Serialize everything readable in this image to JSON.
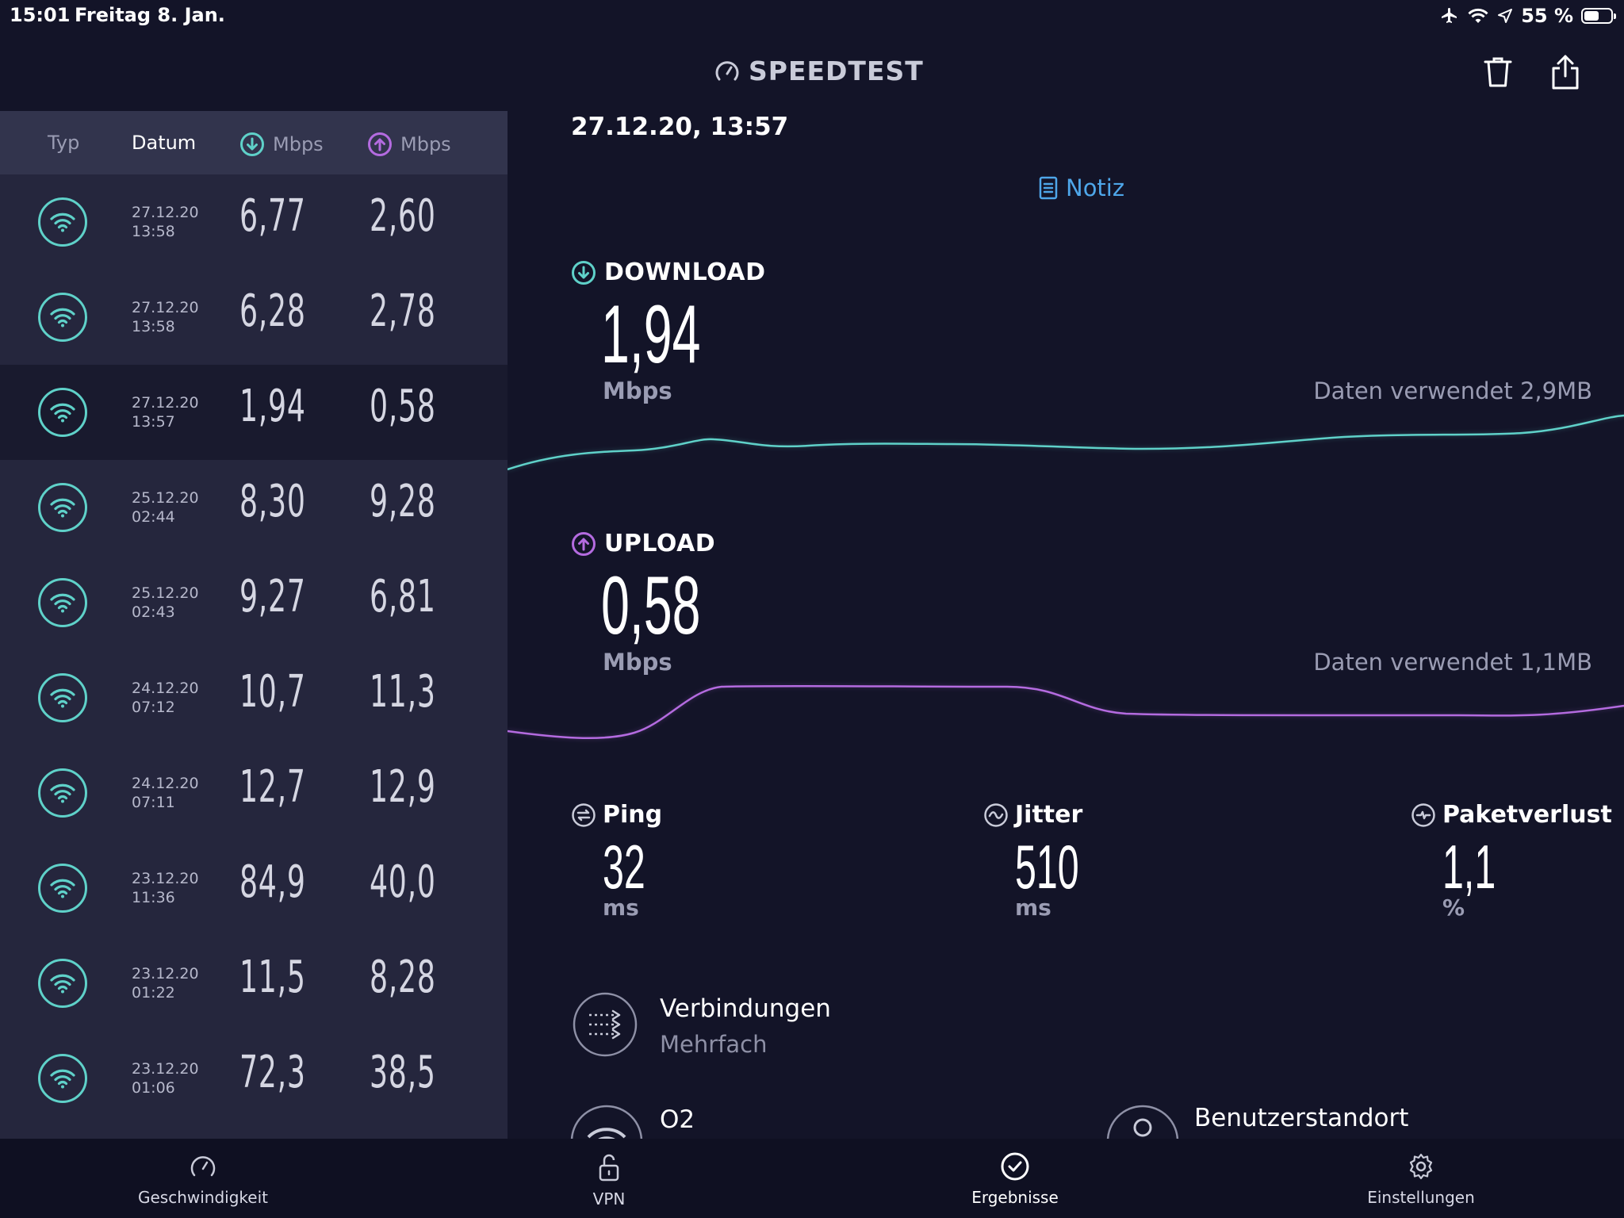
{
  "status_bar": {
    "time": "15:01",
    "date": "Freitag 8. Jan.",
    "battery": "55 %",
    "battery_level": 0.55
  },
  "header": {
    "brand": "SPEEDTEST",
    "delete_icon": "trash-icon",
    "share_icon": "share-icon"
  },
  "history": {
    "columns": {
      "type": "Typ",
      "date": "Datum",
      "download": "Mbps",
      "upload": "Mbps"
    },
    "rows": [
      {
        "date": "27.12.20",
        "time": "13:58",
        "download": "6,77",
        "upload": "2,60",
        "selected": false
      },
      {
        "date": "27.12.20",
        "time": "13:58",
        "download": "6,28",
        "upload": "2,78",
        "selected": false
      },
      {
        "date": "27.12.20",
        "time": "13:57",
        "download": "1,94",
        "upload": "0,58",
        "selected": true
      },
      {
        "date": "25.12.20",
        "time": "02:44",
        "download": "8,30",
        "upload": "9,28",
        "selected": false
      },
      {
        "date": "25.12.20",
        "time": "02:43",
        "download": "9,27",
        "upload": "6,81",
        "selected": false
      },
      {
        "date": "24.12.20",
        "time": "07:12",
        "download": "10,7",
        "upload": "11,3",
        "selected": false
      },
      {
        "date": "24.12.20",
        "time": "07:11",
        "download": "12,7",
        "upload": "12,9",
        "selected": false
      },
      {
        "date": "23.12.20",
        "time": "11:36",
        "download": "84,9",
        "upload": "40,0",
        "selected": false
      },
      {
        "date": "23.12.20",
        "time": "01:22",
        "download": "11,5",
        "upload": "8,28",
        "selected": false
      },
      {
        "date": "23.12.20",
        "time": "01:06",
        "download": "72,3",
        "upload": "38,5",
        "selected": false
      }
    ]
  },
  "result": {
    "datetime": "27.12.20, 13:57",
    "note_label": "Notiz",
    "download": {
      "title": "DOWNLOAD",
      "value": "1,94",
      "unit": "Mbps",
      "data_used": "Daten verwendet 2,9MB",
      "color": "#5fd1c9"
    },
    "upload": {
      "title": "UPLOAD",
      "value": "0,58",
      "unit": "Mbps",
      "data_used": "Daten verwendet 1,1MB",
      "color": "#b46be0"
    },
    "ping": {
      "title": "Ping",
      "value": "32",
      "unit": "ms"
    },
    "jitter": {
      "title": "Jitter",
      "value": "510",
      "unit": "ms"
    },
    "packet_loss": {
      "title": "Paketverlust",
      "value": "1,1",
      "unit": "%"
    },
    "connections": {
      "title": "Verbindungen",
      "value": "Mehrfach"
    },
    "provider": {
      "name": "O2"
    },
    "location": {
      "label": "Benutzerstandort"
    }
  },
  "tabs": [
    {
      "label": "Geschwindigkeit",
      "icon": "speedometer-icon"
    },
    {
      "label": "VPN",
      "icon": "lock-open-icon"
    },
    {
      "label": "Ergebnisse",
      "icon": "check-circle-icon"
    },
    {
      "label": "Einstellungen",
      "icon": "gear-icon"
    }
  ]
}
